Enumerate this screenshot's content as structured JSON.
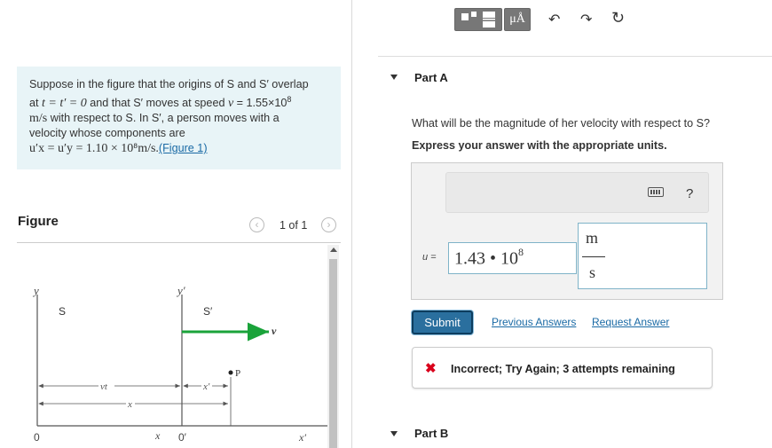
{
  "problem": {
    "line1": "Suppose in the figure that the origins of S and S′ overlap",
    "line2_pre": "at ",
    "line2_math": "t = t′ = 0",
    "line2_mid": " and that S′ moves at speed ",
    "line2_v": "v",
    "line2_val": " = 1.55×10",
    "line2_exp": "8",
    "line3_unit": "m/s",
    "line3_rest": " with respect to S. In S′, a person moves with a",
    "line4": "velocity whose components are",
    "line5_math": "u′x = u′y = 1.10 × 10⁸m/s.",
    "figure_link": "(Figure 1)"
  },
  "figure": {
    "title": "Figure",
    "pager": "1 of 1",
    "labels": {
      "y": "y",
      "S": "S",
      "y_prime": "y′",
      "S_prime": "S′",
      "v": "v⃗",
      "P": "P",
      "vt": "vt",
      "x_prime_span": "x′",
      "x_span": "x",
      "origin": "0",
      "x_axis": "x",
      "origin_prime": "0′",
      "x_prime_axis": "x′"
    },
    "colors": {
      "velocity_arrow": "#1aa33a"
    }
  },
  "part_a": {
    "title": "Part A",
    "question": "What will be the magnitude of her velocity with respect to S?",
    "instruction": "Express your answer with the appropriate units.",
    "toolbar": {
      "templates_icon": "fraction-template-icon",
      "units_label": "μÅ",
      "undo_icon": "undo-icon",
      "redo_icon": "redo-icon",
      "reset_icon": "reset-icon",
      "keyboard_icon": "keyboard-icon",
      "help_label": "?"
    },
    "variable": "u =",
    "value_mantissa": "1.43 • 10",
    "value_exp": "8",
    "units_numerator": "m",
    "units_denominator": "s",
    "submit": "Submit",
    "previous_answers": "Previous Answers",
    "request_answer": "Request Answer",
    "feedback_icon": "✖",
    "feedback": "Incorrect; Try Again; 3 attempts remaining"
  },
  "part_b": {
    "title": "Part B"
  }
}
